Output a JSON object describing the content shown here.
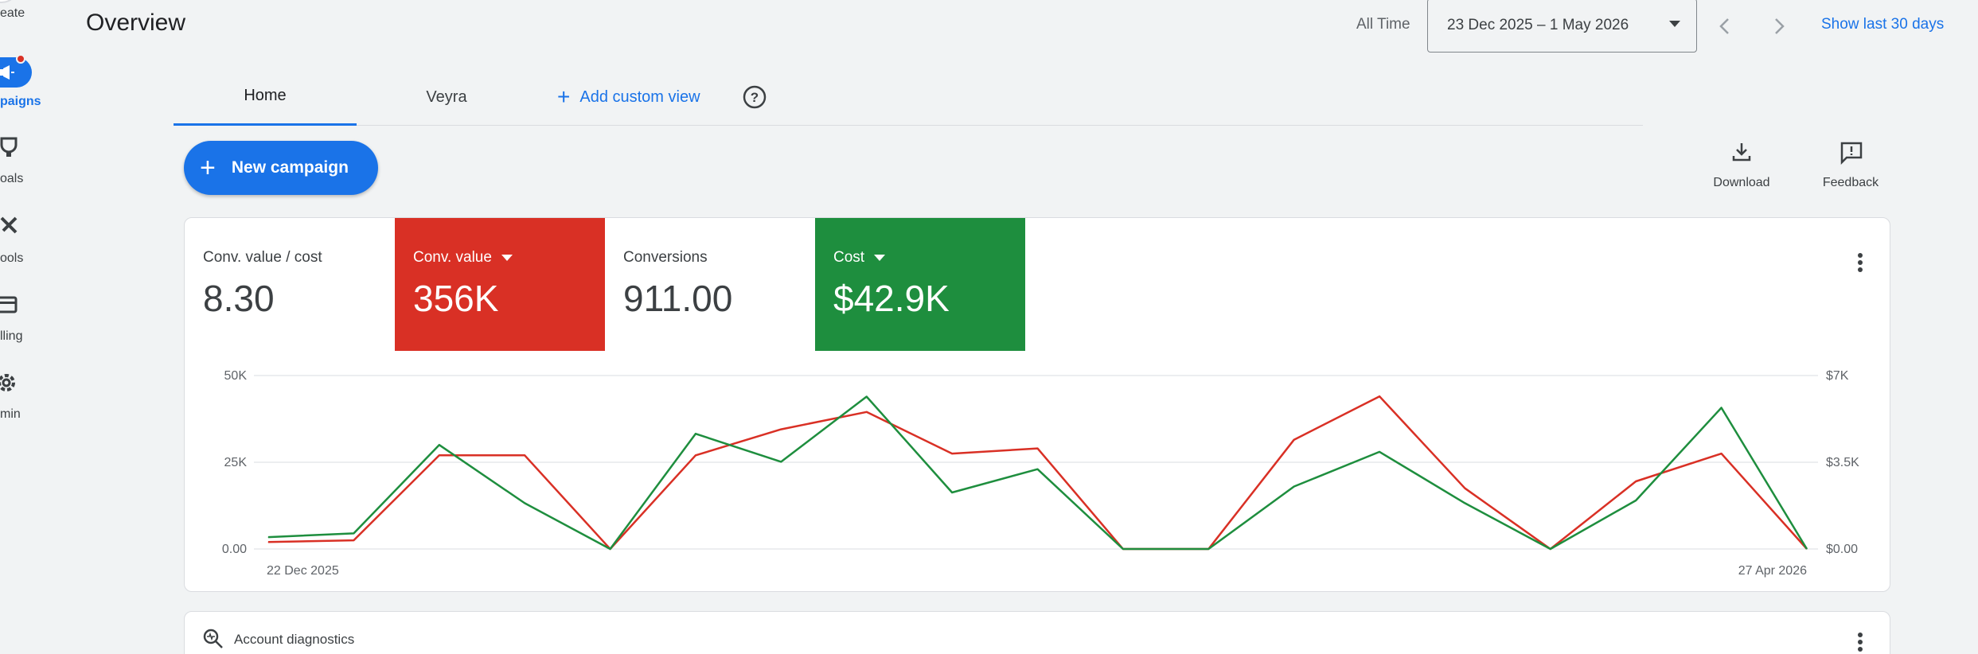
{
  "rail": {
    "items": [
      {
        "label": "eate",
        "icon": "create-icon"
      },
      {
        "label": "paigns",
        "icon": "campaigns-icon",
        "active": true
      },
      {
        "label": "oals",
        "icon": "goals-icon"
      },
      {
        "label": "ools",
        "icon": "tools-icon"
      },
      {
        "label": "lling",
        "icon": "billing-icon"
      },
      {
        "label": "min",
        "icon": "admin-icon"
      }
    ]
  },
  "header": {
    "title": "Overview",
    "range_label": "All Time",
    "date_range": "23 Dec 2025 – 1 May 2026",
    "show_last": "Show last 30 days"
  },
  "tabs": {
    "home": "Home",
    "veyra": "Veyra",
    "add_custom": "Add custom view"
  },
  "actions": {
    "new_campaign": "New campaign",
    "download": "Download",
    "feedback": "Feedback"
  },
  "metrics": [
    {
      "label": "Conv. value / cost",
      "value": "8.30"
    },
    {
      "label": "Conv. value",
      "value": "356K",
      "color": "#d93025"
    },
    {
      "label": "Conversions",
      "value": "911.00"
    },
    {
      "label": "Cost",
      "value": "$42.9K",
      "color": "#1e8e3e"
    }
  ],
  "chart_data": {
    "type": "line",
    "x_start_label": "22 Dec 2025",
    "x_end_label": "27 Apr 2026",
    "left_axis_ticks": [
      "50K",
      "25K",
      "0.00"
    ],
    "right_axis_ticks": [
      "$7K",
      "$3.5K",
      "$0.00"
    ],
    "left_ylim": [
      0,
      50000
    ],
    "right_ylim": [
      0,
      7000
    ],
    "series": [
      {
        "name": "Conv. value",
        "color": "#d93025",
        "axis": "left",
        "values": [
          2000,
          2500,
          27000,
          27000,
          0,
          27000,
          34500,
          39500,
          27500,
          29000,
          0,
          0,
          31500,
          44000,
          17500,
          0,
          19500,
          27500,
          0
        ]
      },
      {
        "name": "Cost",
        "color": "#1e8e3e",
        "axis": "right",
        "values": [
          480,
          630,
          4200,
          1850,
          0,
          4650,
          3520,
          6150,
          2280,
          3220,
          0,
          0,
          2520,
          3920,
          1850,
          0,
          1960,
          5700,
          0
        ]
      }
    ]
  },
  "diagnostics": {
    "label": "Account diagnostics"
  }
}
